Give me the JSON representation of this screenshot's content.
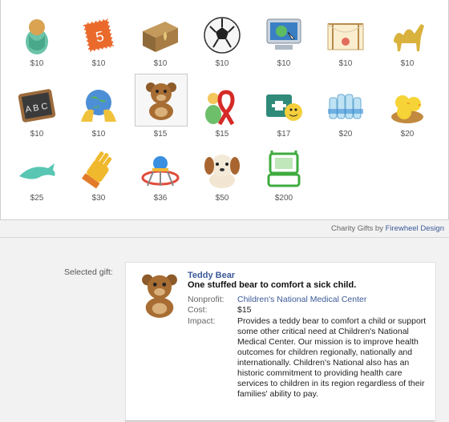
{
  "gifts": [
    {
      "name": "Swaddled Baby",
      "price": "$10"
    },
    {
      "name": "Stamp",
      "price": "$10"
    },
    {
      "name": "Fleur-de-lis Crate",
      "price": "$10"
    },
    {
      "name": "Soccer Ball",
      "price": "$10"
    },
    {
      "name": "Computer",
      "price": "$10"
    },
    {
      "name": "Mosquito Net",
      "price": "$10"
    },
    {
      "name": "Camel",
      "price": "$10"
    },
    {
      "name": "Chalkboard",
      "price": "$10"
    },
    {
      "name": "Hands Globe",
      "price": "$10"
    },
    {
      "name": "Teddy Bear",
      "price": "$15"
    },
    {
      "name": "Red Ribbon",
      "price": "$15"
    },
    {
      "name": "First Aid Kit",
      "price": "$17"
    },
    {
      "name": "Water Bottles",
      "price": "$20"
    },
    {
      "name": "Chicks",
      "price": "$20"
    },
    {
      "name": "Dolphin",
      "price": "$25"
    },
    {
      "name": "Glove",
      "price": "$30"
    },
    {
      "name": "Playground",
      "price": "$36"
    },
    {
      "name": "Puppy",
      "price": "$50"
    },
    {
      "name": "Laptop",
      "price": "$200"
    }
  ],
  "credits": {
    "prefix": "Charity Gifts by",
    "link": "Firewheel Design"
  },
  "selected": {
    "label": "Selected gift:",
    "name": "Teddy Bear",
    "tagline": "One stuffed bear to comfort a sick child.",
    "nonprofit_label": "Nonprofit:",
    "nonprofit": "Children's National Medical Center",
    "cost_label": "Cost:",
    "cost": "$15",
    "impact_label": "Impact:",
    "impact": "Provides a teddy bear to comfort a child or support some other critical need at Children's National Medical Center. Our mission is to improve health outcomes for children regionally, nationally and internationally. Children's National also has an historic commitment to providing health care services to children in its region regardless of their families' ability to pay."
  }
}
